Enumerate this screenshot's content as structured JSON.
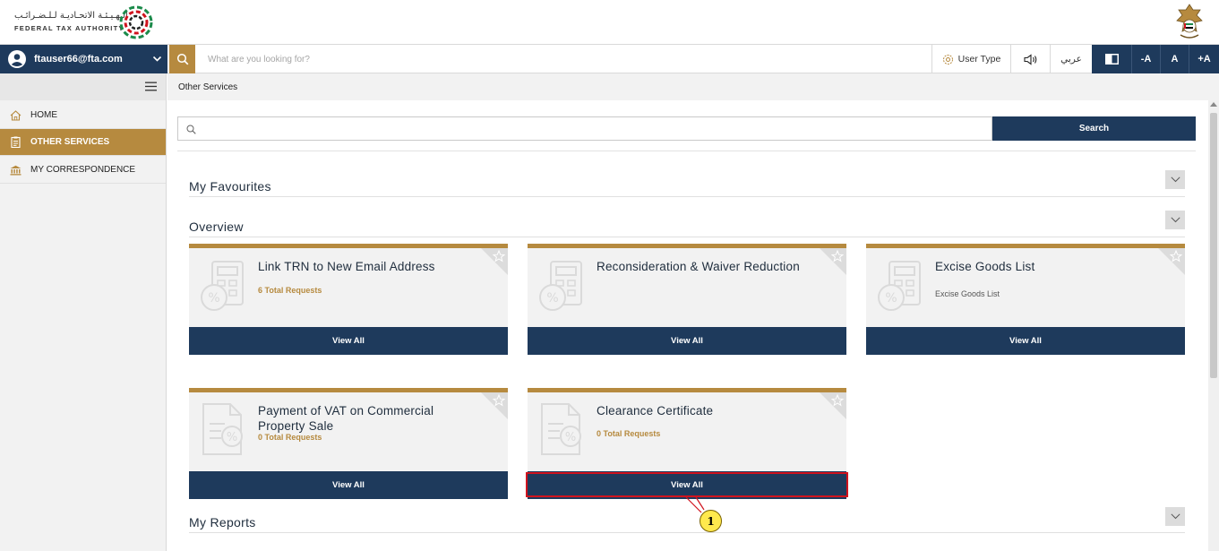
{
  "header": {
    "logo_arabic": "الـهـيـئـة الاتحـاديـة لـلـضـرائـب",
    "logo_english": "FEDERAL TAX AUTHORITY",
    "emblem_icon": "uae-emblem-icon"
  },
  "navbar": {
    "user_email": "ftauser66@fta.com",
    "search_placeholder": "What are you looking for?",
    "user_type_label": "User Type",
    "language_label": "عربي",
    "font_decrease": "-A",
    "font_normal": "A",
    "font_increase": "+A"
  },
  "sidebar": {
    "items": [
      {
        "label": "HOME",
        "icon": "home-icon",
        "active": false
      },
      {
        "label": "OTHER SERVICES",
        "icon": "clipboard-icon",
        "active": true
      },
      {
        "label": "MY CORRESPONDENCE",
        "icon": "bank-icon",
        "active": false
      }
    ]
  },
  "breadcrumb": "Other Services",
  "service_search": {
    "value": "",
    "button_label": "Search"
  },
  "sections": {
    "favourites": "My Favourites",
    "overview": "Overview",
    "reports": "My Reports"
  },
  "cards": [
    {
      "title": "Link TRN to New Email Address",
      "subtitle": "6 Total Requests",
      "button": "View All"
    },
    {
      "title": "Reconsideration & Waiver Reduction",
      "subtitle": "",
      "button": "View All"
    },
    {
      "title": "Excise Goods List",
      "subtitle": "Excise Goods List",
      "button": "View All"
    },
    {
      "title": "Payment of VAT on Commercial Property Sale",
      "subtitle": "0 Total Requests",
      "button": "View All"
    },
    {
      "title": "Clearance Certificate",
      "subtitle": "0 Total Requests",
      "button": "View All"
    }
  ],
  "annotation": {
    "callout_number": "1",
    "highlight_color": "#d0131e",
    "callout_color": "#ffe94d"
  },
  "colors": {
    "navy": "#1e3a5c",
    "gold": "#b68a3f",
    "card_bg": "#f2f2f2"
  }
}
